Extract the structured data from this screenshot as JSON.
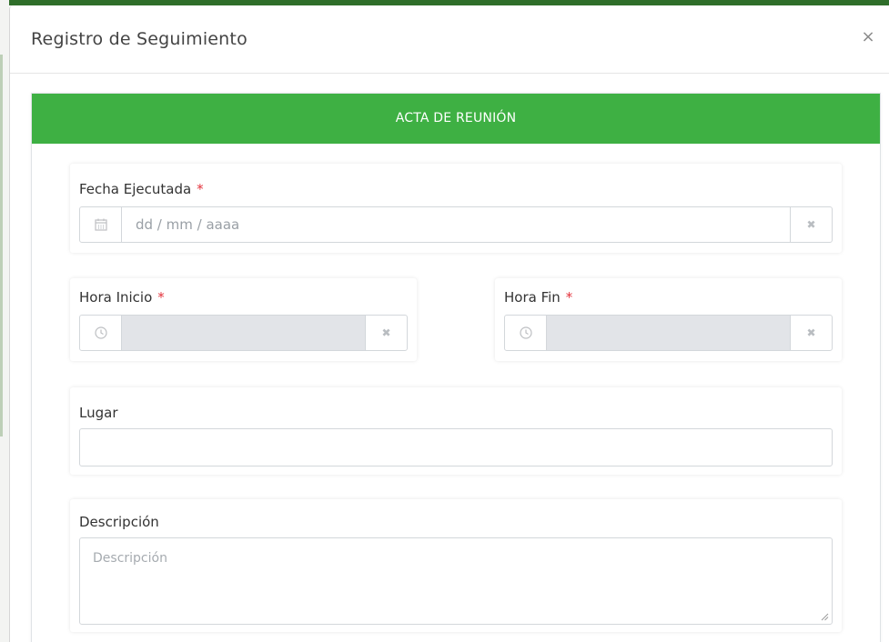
{
  "modal": {
    "title": "Registro de Seguimiento",
    "close_glyph": "×"
  },
  "panel": {
    "heading": "ACTA DE REUNIÓN"
  },
  "form": {
    "fecha": {
      "label": "Fecha Ejecutada",
      "required_mark": "*",
      "placeholder": "dd / mm / aaaa",
      "icon": "calendar-icon",
      "clear_glyph": "✖"
    },
    "hora_inicio": {
      "label": "Hora Inicio",
      "required_mark": "*",
      "icon": "clock-icon",
      "clear_glyph": "✖"
    },
    "hora_fin": {
      "label": "Hora Fin",
      "required_mark": "*",
      "icon": "clock-icon",
      "clear_glyph": "✖"
    },
    "lugar": {
      "label": "Lugar",
      "value": ""
    },
    "descripcion": {
      "label": "Descripción",
      "placeholder": "Descripción"
    }
  },
  "colors": {
    "accent": "#3eb043",
    "required": "#e3323b",
    "disabled_field": "#e2e4e8"
  }
}
